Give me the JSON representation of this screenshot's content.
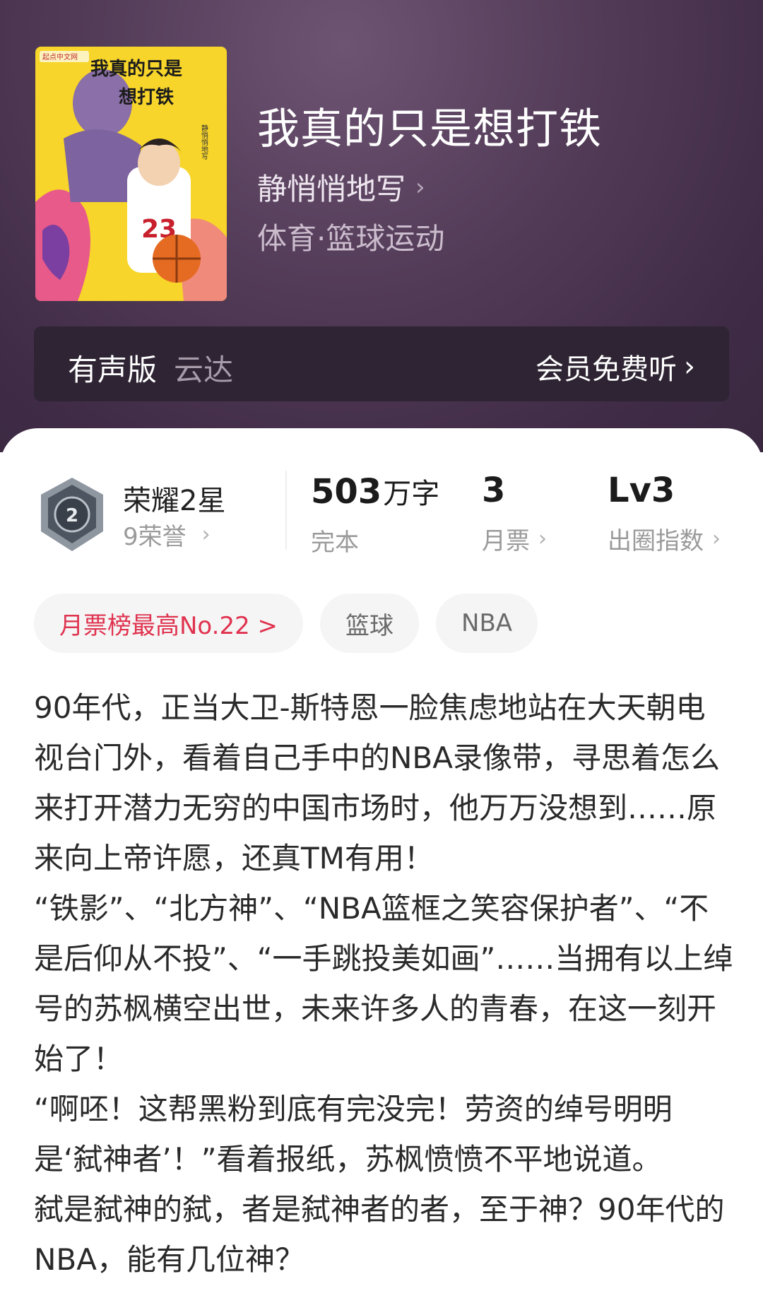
{
  "book": {
    "title": "我真的只是想打铁",
    "author": "静悄悄地写",
    "category": "体育·篮球运动"
  },
  "cover": {
    "publisher": "起点中文网",
    "title_lines": [
      "我真的只是",
      "想打铁"
    ],
    "author": "静悄悄地写",
    "jersey_number": "23"
  },
  "audio": {
    "label": "有声版",
    "narrator": "云达",
    "cta": "会员免费听"
  },
  "rank": {
    "badge_number": "2",
    "title": "荣耀2星",
    "honors": "9荣誉"
  },
  "stats": [
    {
      "value": "503",
      "unit": "万字",
      "label": "完本"
    },
    {
      "value": "3",
      "unit": "",
      "label": "月票"
    },
    {
      "value": "Lv3",
      "unit": "",
      "label": "出圈指数"
    }
  ],
  "tags": [
    "月票榜最高No.22 >",
    "篮球",
    "NBA"
  ],
  "synopsis": [
    "90年代，正当大卫-斯特恩一脸焦虑地站在大天朝电视台门外，看着自己手中的NBA录像带，寻思着怎么来打开潜力无穷的中国市场时，他万万没想到……原来向上帝许愿，还真TM有用！",
    "“铁影”、“北方神”、“NBA篮框之笑容保护者”、“不是后仰从不投”、“一手跳投美如画”……当拥有以上绰号的苏枫横空出世，未来许多人的青春，在这一刻开始了！",
    "“啊呸！这帮黑粉到底有完没完！劳资的绰号明明是‘弑神者’！”看着报纸，苏枫愤愤不平地说道。",
    "弑是弑神的弑，者是弑神者的者，至于神？90年代的NBA，能有几位神？"
  ],
  "colors": {
    "accent_red": "#e0334f",
    "hero_bg": "#4a3450"
  }
}
